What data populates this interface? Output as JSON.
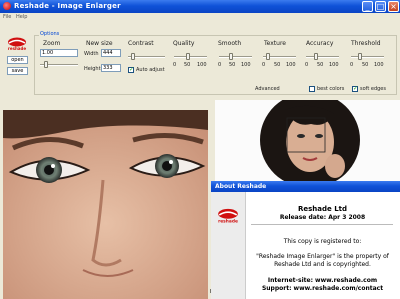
{
  "window": {
    "title": "Reshade - Image Enlarger"
  },
  "menu": {
    "items": [
      "File",
      "Help"
    ]
  },
  "sidebar_buttons": {
    "open": "open",
    "save": "save"
  },
  "options_label": "Options",
  "panel": {
    "zoom_label": "Zoom",
    "zoom_value": "1.00",
    "resize_label": "New size",
    "width_label": "Width",
    "width_value": "444",
    "height_label": "Height",
    "height_value": "333",
    "contrast_label": "Contrast",
    "auto_adjust": "Auto adjust",
    "quality_label": "Quality",
    "smooth_label": "Smooth",
    "texture_label": "Texture",
    "accuracy_label": "Accuracy",
    "threshold_label": "Threshold",
    "range_min": "0",
    "range_mid": "50",
    "range_max": "100",
    "advanced_label": "Advanced",
    "best_colors": "best colors",
    "soft_edges": "soft edges"
  },
  "status_fragment": "B/",
  "about": {
    "title": "About Reshade",
    "company": "Reshade Ltd",
    "release": "Release date: Apr 3 2008",
    "registered": "This copy is registered to:",
    "notice_line1": "\"Reshade Image Enlarger\" is the property of",
    "notice_line2": "Reshade Ltd and is copyrighted.",
    "internet": "Internet-site: www.reshade.com",
    "support": "Support: www.reshade.com/contact"
  },
  "colors": {
    "titlebar": "#0f52d8",
    "panel_bg": "#ece9d8",
    "accent": "#0046d5",
    "logo_red": "#d01010"
  }
}
